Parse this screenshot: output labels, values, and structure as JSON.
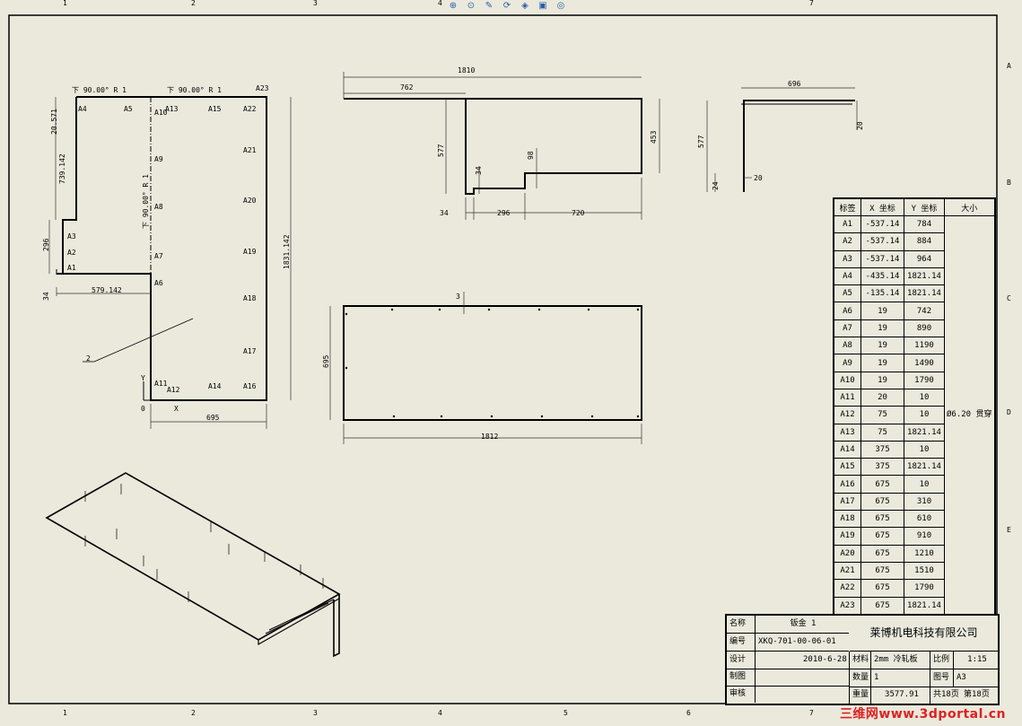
{
  "toolbar": {
    "icons": [
      "zoom-fit-icon",
      "zoom-area-icon",
      "pan-icon",
      "rotate-icon",
      "view-orient-icon",
      "display-style-icon",
      "hide-show-icon"
    ]
  },
  "border_numbers": {
    "top": [
      "1",
      "2",
      "3",
      "4",
      "7"
    ],
    "bottom": [
      "1",
      "2",
      "3",
      "4",
      "5",
      "6",
      "7"
    ],
    "right": [
      "A",
      "B",
      "C",
      "D",
      "E"
    ]
  },
  "flat_pattern": {
    "bend_notes": [
      "下  90.00°  R 1",
      "下  90.00°  R 1",
      "下  90.00°  R 1"
    ],
    "tags": [
      "A1",
      "A2",
      "A3",
      "A4",
      "A5",
      "A6",
      "A7",
      "A8",
      "A9",
      "A10",
      "A11",
      "A12",
      "A13",
      "A14",
      "A15",
      "A16",
      "A17",
      "A18",
      "A19",
      "A20",
      "A21",
      "A22",
      "A23"
    ],
    "dims": [
      "20.571",
      "739.142",
      "296",
      "34",
      "579.142",
      "1831.142",
      "695"
    ],
    "balloon": "2",
    "origin": [
      "Y",
      "0",
      "X"
    ]
  },
  "top_view": {
    "dims": [
      "1810",
      "762",
      "577",
      "34",
      "98",
      "453",
      "34",
      "296",
      "720"
    ]
  },
  "side_view": {
    "dims": [
      "696",
      "577",
      "20",
      "24",
      "20"
    ]
  },
  "front_view": {
    "dims": [
      "3",
      "695",
      "1812"
    ]
  },
  "hole_table": {
    "headers": [
      "标签",
      "X 坐标",
      "Y 坐标",
      "大小"
    ],
    "size": "Ø6.20 贯穿",
    "rows": [
      [
        "A1",
        "-537.14",
        "784"
      ],
      [
        "A2",
        "-537.14",
        "884"
      ],
      [
        "A3",
        "-537.14",
        "964"
      ],
      [
        "A4",
        "-435.14",
        "1821.14"
      ],
      [
        "A5",
        "-135.14",
        "1821.14"
      ],
      [
        "A6",
        "19",
        "742"
      ],
      [
        "A7",
        "19",
        "890"
      ],
      [
        "A8",
        "19",
        "1190"
      ],
      [
        "A9",
        "19",
        "1490"
      ],
      [
        "A10",
        "19",
        "1790"
      ],
      [
        "A11",
        "20",
        "10"
      ],
      [
        "A12",
        "75",
        "10"
      ],
      [
        "A13",
        "75",
        "1821.14"
      ],
      [
        "A14",
        "375",
        "10"
      ],
      [
        "A15",
        "375",
        "1821.14"
      ],
      [
        "A16",
        "675",
        "10"
      ],
      [
        "A17",
        "675",
        "310"
      ],
      [
        "A18",
        "675",
        "610"
      ],
      [
        "A19",
        "675",
        "910"
      ],
      [
        "A20",
        "675",
        "1210"
      ],
      [
        "A21",
        "675",
        "1510"
      ],
      [
        "A22",
        "675",
        "1790"
      ],
      [
        "A23",
        "675",
        "1821.14"
      ]
    ]
  },
  "title_block": {
    "name_label": "名称",
    "name_value": "钣金 1",
    "code_label": "编号",
    "code_value": "XKQ-701-00-06-01",
    "design_label": "设计",
    "design_value": "2010-6-28",
    "draw_label": "制图",
    "check_label": "审核",
    "company": "莱博机电科技有限公司",
    "material_label": "材料",
    "material_value": "2mm 冷轧板",
    "scale_label": "比例",
    "scale_value": "1:15",
    "qty_label": "数量",
    "qty_value": "1",
    "sheet_label": "图号",
    "sheet_value": "A3",
    "weight_label": "重量",
    "weight_value": "3577.91",
    "pages_total": "共18页",
    "pages_current": "第18页"
  },
  "watermark": "三维网www.3dportal.cn"
}
